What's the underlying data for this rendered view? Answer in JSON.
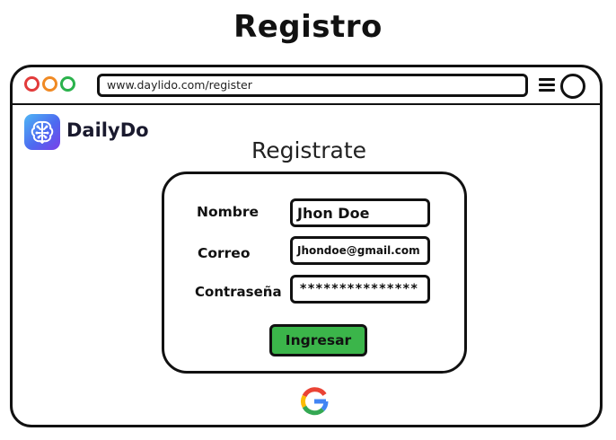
{
  "page": {
    "title": "Registro"
  },
  "browser": {
    "url": "www.daylido.com/register",
    "window_controls": [
      "close-dot-red",
      "minimize-dot-orange",
      "maximize-dot-green"
    ],
    "menu_icon": "hamburger-menu-icon",
    "circle_icon": "circle-icon"
  },
  "brand": {
    "name": "DailyDo",
    "icon": "brain-logo-icon"
  },
  "form": {
    "heading": "Registrate",
    "fields": {
      "name": {
        "label": "Nombre",
        "value": "Jhon Doe"
      },
      "email": {
        "label": "Correo",
        "value": "Jhondoe@gmail.com"
      },
      "password": {
        "label": "Contraseña",
        "value": "***************"
      }
    },
    "submit_label": "Ingresar"
  },
  "social": {
    "icon": "google-icon"
  },
  "colors": {
    "submit": "#3bb54a",
    "dot_red": "#e23b3b",
    "dot_orange": "#f08a24",
    "dot_green": "#2bb24c"
  }
}
